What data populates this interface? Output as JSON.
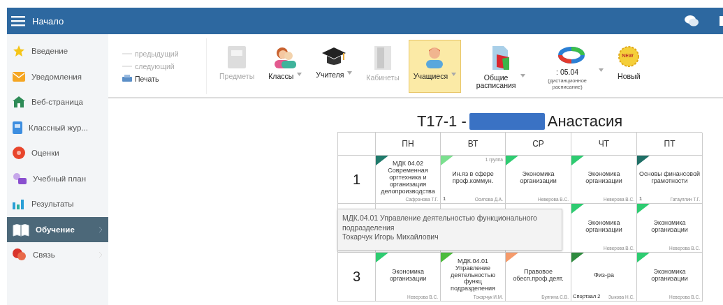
{
  "header": {
    "title": "Начало"
  },
  "sidebar": {
    "items": [
      {
        "label": "Введение",
        "selected": false
      },
      {
        "label": "Уведомления",
        "selected": false
      },
      {
        "label": "Веб-страница",
        "selected": false
      },
      {
        "label": "Классный жур...",
        "selected": false
      },
      {
        "label": "Оценки",
        "selected": false
      },
      {
        "label": "Учебный план",
        "selected": false
      },
      {
        "label": "Результаты",
        "selected": false
      },
      {
        "label": "Обучение",
        "selected": true,
        "expandable": true
      },
      {
        "label": "Связь",
        "selected": false,
        "expandable": true
      }
    ]
  },
  "toolbar": {
    "nav": [
      {
        "label": "предыдущий",
        "disabled": true,
        "kind": "arrow"
      },
      {
        "label": "следующий",
        "disabled": true,
        "kind": "arrow"
      },
      {
        "label": "Печать",
        "disabled": false,
        "kind": "print"
      }
    ],
    "buttons": [
      {
        "kind": "subjects",
        "label": "Предметы",
        "disabled": true,
        "dropdown": false,
        "selected": false
      },
      {
        "kind": "classes",
        "label": "Классы",
        "disabled": false,
        "dropdown": true,
        "selected": false
      },
      {
        "kind": "teachers",
        "label": "Учителя",
        "disabled": false,
        "dropdown": true,
        "selected": false
      },
      {
        "kind": "rooms",
        "label": "Кабинеты",
        "disabled": true,
        "dropdown": false,
        "selected": false
      },
      {
        "kind": "students",
        "label": "Учащиеся",
        "disabled": false,
        "dropdown": true,
        "selected": true
      },
      {
        "kind": "schedules",
        "label": "Общие расписания",
        "disabled": false,
        "dropdown": true,
        "selected": false
      },
      {
        "kind": "date",
        "label": ": 05.04",
        "sublabel": "(дистанционное расписание)",
        "disabled": false,
        "dropdown": true,
        "selected": false
      },
      {
        "kind": "new",
        "label": "Новый",
        "badge": "NEW",
        "disabled": false,
        "dropdown": false,
        "selected": false
      }
    ]
  },
  "timetable": {
    "title_start": "T17-1 -",
    "title_end": "Анастасия",
    "columns": [
      "ПН",
      "ВТ",
      "СР",
      "ЧТ",
      "ПТ"
    ],
    "rows": [
      {
        "period": "1",
        "cells": [
          {
            "subject": "МДК 04.02 Современная оргтехника и организация делопроизводства",
            "teacher": "Сафронова Т.Г.",
            "color": "#1f7a6b"
          },
          {
            "subject": "Ин.яз в сфере проф.коммун.",
            "teacher": "Осипова Д.А.",
            "group": "1 группа",
            "number": "1",
            "color": "#7be08f"
          },
          {
            "subject": "Экономика организации",
            "teacher": "Неверова В.С.",
            "color": "#2ecc71"
          },
          {
            "subject": "Экономика организации",
            "teacher": "Неверова В.С.",
            "color": "#2ecc71"
          },
          {
            "subject": "Основы финансовой грамотности",
            "teacher": "Гатауллин Т.Г.",
            "number": "1",
            "color": "#1f6f66"
          }
        ]
      },
      {
        "cells": [
          null,
          null,
          null,
          {
            "subject": "Экономика организации",
            "teacher": "Неверова В.С.",
            "color": "#2ecc71"
          },
          {
            "subject": "Экономика организации",
            "teacher": "Неверова В.С.",
            "color": "#2ecc71"
          }
        ]
      },
      {
        "period": "3",
        "cells": [
          {
            "subject": "Экономика организации",
            "teacher": "Неверова В.С.",
            "color": "#2ecc71"
          },
          {
            "subject": "МДК.04.01 Управление деятельностью функц подразделения",
            "teacher": "Токарчук И.М.",
            "color": "#4cbb3c"
          },
          {
            "subject": "Правовое обесп.проф.деят.",
            "teacher": "Булгина С.В.",
            "color": "#f59b6b"
          },
          {
            "subject": "Физ-ра",
            "teacher": "Зыкова Н.С.",
            "room": "Спортзал 2",
            "color": "#2e8b3e"
          },
          {
            "subject": "Экономика организации",
            "teacher": "Неверова В.С.",
            "color": "#2ecc71"
          }
        ]
      }
    ],
    "tooltip": {
      "lines": [
        "МДК.04.01 Управление деятельностью функционального подразделения",
        "Токарчук Игорь Михайлович"
      ]
    }
  }
}
